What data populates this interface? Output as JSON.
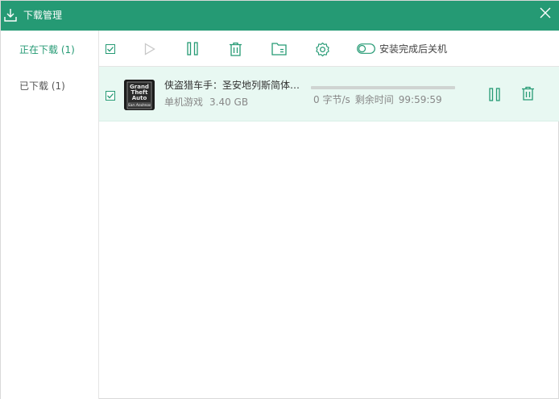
{
  "window": {
    "title": "下载管理"
  },
  "sidebar": {
    "items": [
      {
        "label": "正在下载 (1)",
        "active": true
      },
      {
        "label": "已下载 (1)",
        "active": false
      }
    ]
  },
  "toolbar": {
    "shutdown_toggle_label": "安装完成后关机",
    "shutdown_toggle_on": false
  },
  "downloads": [
    {
      "name": "侠盗猎车手：圣安地列斯简体…",
      "category": "单机游戏",
      "size": "3.40 GB",
      "progress": 0,
      "speed": "0 字节/s",
      "remaining_label": "剩余时间",
      "remaining": "99:59:59",
      "checked": true,
      "thumb_text": [
        "Grand",
        "Theft",
        "Auto",
        "San Andreas"
      ]
    }
  ],
  "colors": {
    "accent": "#259a74",
    "titlebar": "#259a74",
    "row_bg": "#e8f8f2",
    "icon_disabled": "#c8c8c8"
  }
}
